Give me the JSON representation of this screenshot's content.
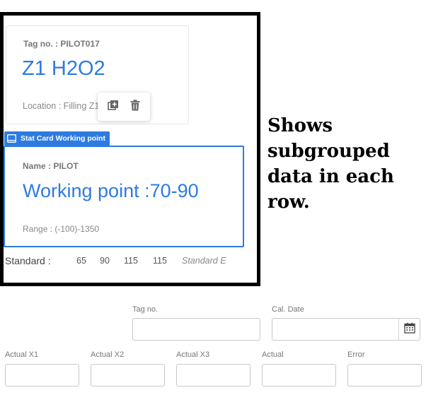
{
  "card1": {
    "tag_label": "Tag no. : PILOT017",
    "title": "Z1 H2O2",
    "location": "Location : Filling Z1"
  },
  "toolbar": {
    "duplicate_icon": "duplicate-icon",
    "delete_icon": "trash-icon"
  },
  "stat_card": {
    "tag_text": "Stat Card Working point",
    "tag_icon": "monitor-icon",
    "name_label": "Name  : PILOT",
    "title": "Working point :70-90",
    "range": "Range : (-100)-1350"
  },
  "standard": {
    "label": "Standard :",
    "values": [
      "65",
      "90",
      "115",
      "115"
    ],
    "placeholder": "Standard E"
  },
  "annotation": "Shows subgrouped data in each row.",
  "form": {
    "tag_no_label": "Tag no.",
    "cal_date_label": "Cal. Date",
    "actual_x1_label": "Actual X1",
    "actual_x2_label": "Actual X2",
    "actual_x3_label": "Actual X3",
    "actual_label": "Actual",
    "error_label": "Error",
    "calendar_icon": "calendar-icon"
  },
  "colors": {
    "accent": "#2d7be0",
    "frame": "#000000"
  }
}
